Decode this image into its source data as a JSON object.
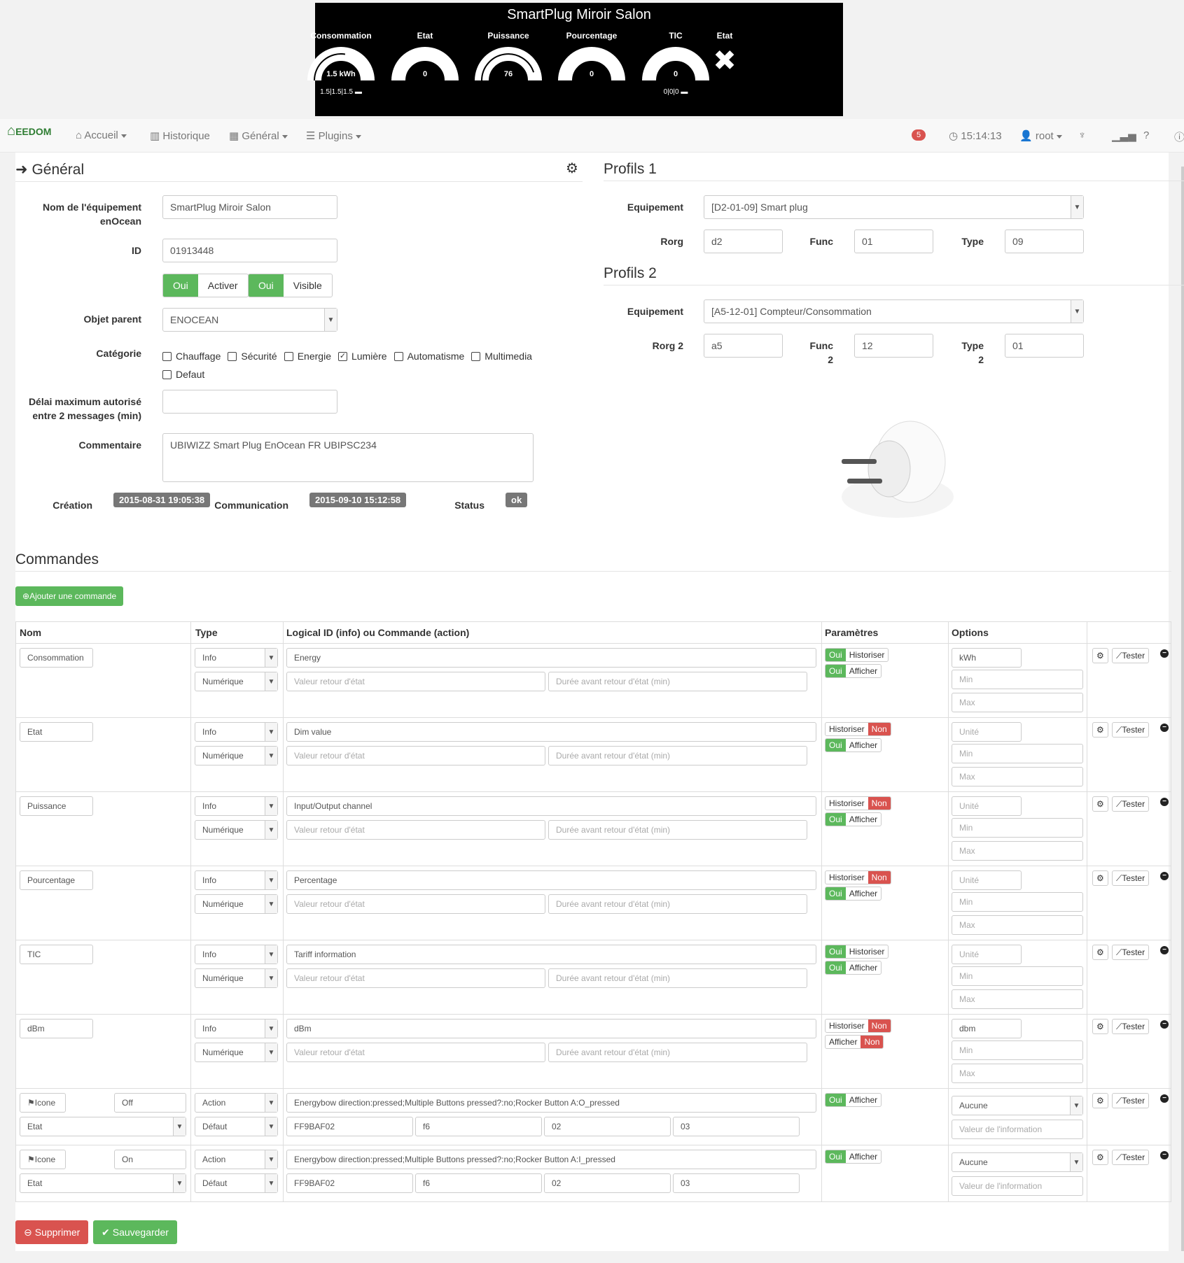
{
  "widget": {
    "title": "SmartPlug Miroir Salon",
    "gauges": [
      {
        "label": "Consommation",
        "value": "1.5 kWh",
        "sub": "1.5|1.5|1.5 ▬",
        "level": 0.55
      },
      {
        "label": "Etat",
        "value": "0",
        "sub": "",
        "level": 0
      },
      {
        "label": "Puissance",
        "value": "76",
        "sub": "",
        "level": 0.9
      },
      {
        "label": "Pourcentage",
        "value": "0",
        "sub": "",
        "level": 0
      },
      {
        "label": "TIC",
        "value": "0",
        "sub": "0|0|0 ▬",
        "level": 0
      }
    ],
    "state_label": "Etat",
    "state_icon": "✖"
  },
  "navbar": {
    "brand": "EEDOM",
    "items": [
      "Accueil",
      "Historique",
      "Général",
      "Plugins"
    ],
    "badge": "5",
    "time": "15:14:13",
    "user": "root"
  },
  "general": {
    "title": "Général",
    "name_label": "Nom de l'équipement enOcean",
    "name_value": "SmartPlug Miroir Salon",
    "id_label": "ID",
    "id_value": "01913448",
    "oui1": "Oui",
    "activer": "Activer",
    "oui2": "Oui",
    "visible": "Visible",
    "parent_label": "Objet parent",
    "parent_value": "ENOCEAN",
    "cat_label": "Catégorie",
    "categories": [
      {
        "name": "Chauffage",
        "checked": false
      },
      {
        "name": "Sécurité",
        "checked": false
      },
      {
        "name": "Energie",
        "checked": false
      },
      {
        "name": "Lumière",
        "checked": true
      },
      {
        "name": "Automatisme",
        "checked": false
      },
      {
        "name": "Multimedia",
        "checked": false
      },
      {
        "name": "Defaut",
        "checked": false
      }
    ],
    "delay_label": "Délai maximum autorisé entre 2 messages (min)",
    "comment_label": "Commentaire",
    "comment_value": "UBIWIZZ Smart Plug EnOcean FR UBIPSC234",
    "creation_label": "Création",
    "creation_value": "2015-08-31 19:05:38",
    "comm_label": "Communication",
    "comm_value": "2015-09-10 15:12:58",
    "status_label": "Status",
    "status_value": "ok"
  },
  "profils1": {
    "title": "Profils 1",
    "equip_label": "Equipement",
    "equip_value": "[D2-01-09] Smart plug",
    "rorg_label": "Rorg",
    "rorg": "d2",
    "func_label": "Func",
    "func": "01",
    "type_label": "Type",
    "type": "09"
  },
  "profils2": {
    "title": "Profils 2",
    "equip_label": "Equipement",
    "equip_value": "[A5-12-01] Compteur/Consommation",
    "rorg_label": "Rorg 2",
    "rorg": "a5",
    "func_label": "Func 2",
    "func": "12",
    "type_label": "Type 2",
    "type": "01"
  },
  "commands": {
    "title": "Commandes",
    "add": "Ajouter une commande",
    "headers": [
      "Nom",
      "Type",
      "Logical ID (info) ou Commande (action)",
      "Paramètres",
      "Options"
    ],
    "rows": [
      {
        "name": "Consommation",
        "type": "Info",
        "subtype": "Numérique",
        "logical": "Energy",
        "hist": "Historiser",
        "histOn": true,
        "aff": "Afficher",
        "affOn": true,
        "unit": "kWh"
      },
      {
        "name": "Etat",
        "type": "Info",
        "subtype": "Numérique",
        "logical": "Dim value",
        "hist": "Historiser",
        "histOn": false,
        "aff": "Afficher",
        "affOn": true,
        "unit": ""
      },
      {
        "name": "Puissance",
        "type": "Info",
        "subtype": "Numérique",
        "logical": "Input/Output channel",
        "hist": "Historiser",
        "histOn": false,
        "aff": "Afficher",
        "affOn": true,
        "unit": ""
      },
      {
        "name": "Pourcentage",
        "type": "Info",
        "subtype": "Numérique",
        "logical": "Percentage",
        "hist": "Historiser",
        "histOn": false,
        "aff": "Afficher",
        "affOn": true,
        "unit": ""
      },
      {
        "name": "TIC",
        "type": "Info",
        "subtype": "Numérique",
        "logical": "Tariff information",
        "hist": "Historiser",
        "histOn": true,
        "aff": "Afficher",
        "affOn": true,
        "unit": ""
      },
      {
        "name": "dBm",
        "type": "Info",
        "subtype": "Numérique",
        "logical": "dBm",
        "hist": "Historiser",
        "histOn": false,
        "aff": "Afficher",
        "affOn": false,
        "unit": "dbm"
      }
    ],
    "actions": [
      {
        "icon": "Icone",
        "name": "Off",
        "type": "Action",
        "subtype": "Défaut",
        "etat": "Etat",
        "logical": "Energybow direction:pressed;Multiple Buttons pressed?:no;Rocker Button A:O_pressed",
        "f1": "FF9BAF02",
        "f2": "f6",
        "f3": "02",
        "f4": "03",
        "aff": "Afficher",
        "opt": "Aucune"
      },
      {
        "icon": "Icone",
        "name": "On",
        "type": "Action",
        "subtype": "Défaut",
        "etat": "Etat",
        "logical": "Energybow direction:pressed;Multiple Buttons pressed?:no;Rocker Button A:I_pressed",
        "f1": "FF9BAF02",
        "f2": "f6",
        "f3": "02",
        "f4": "03",
        "aff": "Afficher",
        "opt": "Aucune"
      }
    ],
    "ph": {
      "retour": "Valeur retour d'état",
      "duree": "Durée avant retour d'état (min)",
      "unite": "Unité",
      "min": "Min",
      "max": "Max",
      "valinfo": "Valeur de l'information"
    },
    "oui": "Oui",
    "non": "Non",
    "tester": "Tester"
  },
  "footer": {
    "delete": "Supprimer",
    "save": "Sauvegarder"
  }
}
